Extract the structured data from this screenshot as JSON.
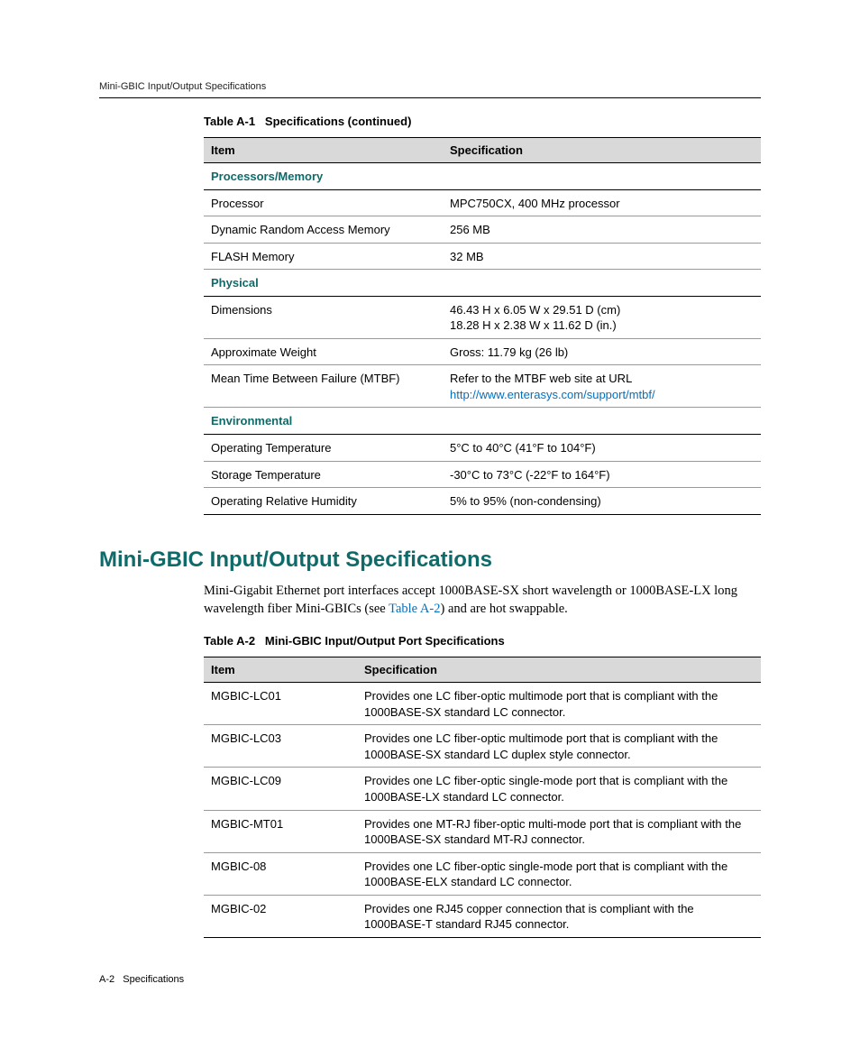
{
  "header": {
    "running": "Mini-GBIC Input/Output Specifications"
  },
  "table1": {
    "caption_prefix": "Table A-1",
    "caption": "Specifications (continued)",
    "head": {
      "item": "Item",
      "spec": "Specification"
    },
    "sections": [
      {
        "title": "Processors/Memory",
        "rows": [
          {
            "item": "Processor",
            "spec": "MPC750CX, 400 MHz processor"
          },
          {
            "item": "Dynamic Random Access Memory",
            "spec": "256 MB"
          },
          {
            "item": "FLASH Memory",
            "spec": "32 MB"
          }
        ]
      },
      {
        "title": "Physical",
        "rows": [
          {
            "item": "Dimensions",
            "spec": "46.43 H x 6.05 W x 29.51 D (cm)\n18.28 H x 2.38 W x 11.62 D (in.)"
          },
          {
            "item": "Approximate Weight",
            "spec": "Gross: 11.79 kg (26 lb)"
          },
          {
            "item": "Mean Time Between Failure (MTBF)",
            "spec": "Refer to the MTBF web site at URL",
            "link": "http://www.enterasys.com/support/mtbf/"
          }
        ]
      },
      {
        "title": "Environmental",
        "rows": [
          {
            "item": "Operating Temperature",
            "spec": "5°C to 40°C (41°F to 104°F)"
          },
          {
            "item": "Storage Temperature",
            "spec": "-30°C to 73°C (-22°F to 164°F)"
          },
          {
            "item": "Operating Relative Humidity",
            "spec": "5% to 95% (non-condensing)"
          }
        ]
      }
    ]
  },
  "section": {
    "title": "Mini-GBIC Input/Output Specifications",
    "body_pre": "Mini-Gigabit Ethernet port interfaces accept 1000BASE-SX short wavelength or 1000BASE-LX long wavelength fiber Mini-GBICs (see ",
    "body_link": "Table A-2",
    "body_post": ") and are hot swappable."
  },
  "table2": {
    "caption_prefix": "Table A-2",
    "caption": "Mini-GBIC Input/Output Port Specifications",
    "head": {
      "item": "Item",
      "spec": "Specification"
    },
    "rows": [
      {
        "item": "MGBIC-LC01",
        "spec": "Provides one LC fiber-optic multimode port that is compliant with the 1000BASE-SX standard LC connector."
      },
      {
        "item": "MGBIC-LC03",
        "spec": "Provides one LC fiber-optic multimode port that is compliant with the 1000BASE-SX standard LC duplex style connector."
      },
      {
        "item": "MGBIC-LC09",
        "spec": "Provides one LC fiber-optic single-mode port that is compliant with the 1000BASE-LX standard LC connector."
      },
      {
        "item": "MGBIC-MT01",
        "spec": "Provides one MT-RJ fiber-optic multi-mode port that is compliant with the 1000BASE-SX standard MT-RJ connector."
      },
      {
        "item": "MGBIC-08",
        "spec": "Provides one LC fiber-optic single-mode port that is compliant with the 1000BASE-ELX standard LC connector."
      },
      {
        "item": "MGBIC-02",
        "spec": "Provides one RJ45 copper connection that is compliant with the 1000BASE-T standard RJ45 connector."
      }
    ]
  },
  "footer": {
    "page": "A-2",
    "label": "Specifications"
  }
}
